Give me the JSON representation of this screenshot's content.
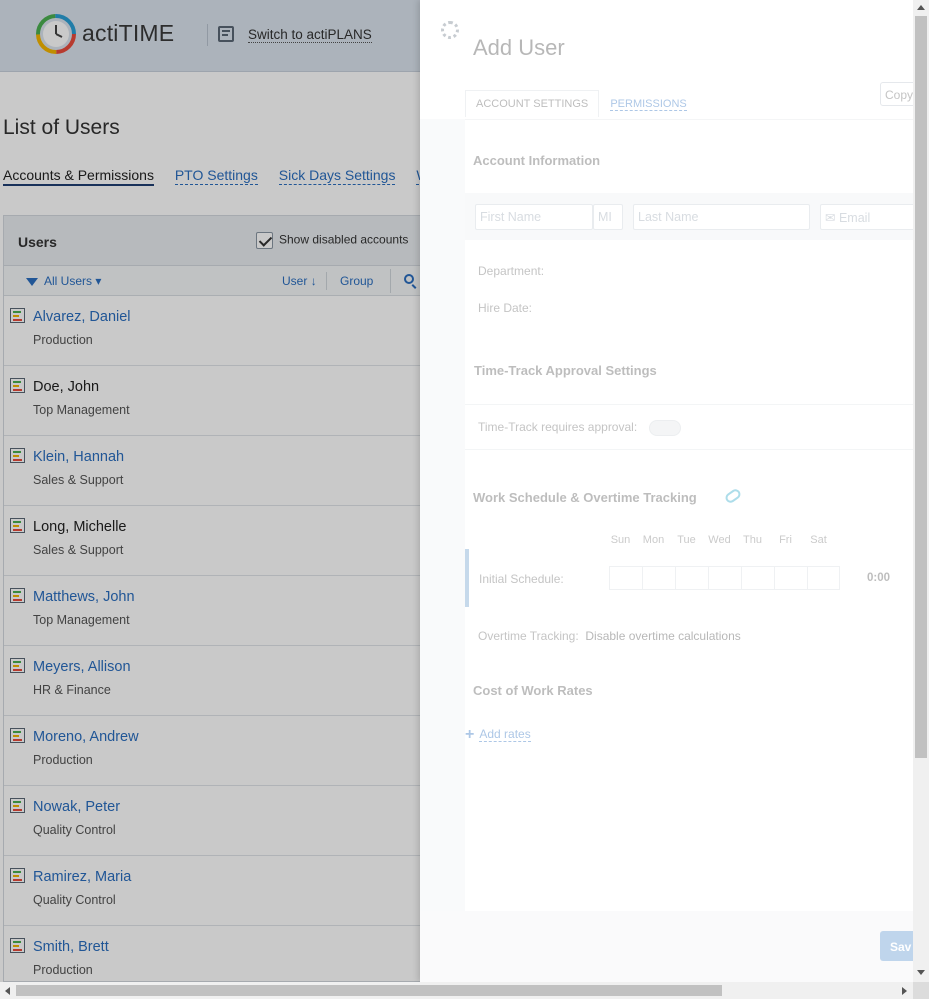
{
  "header": {
    "app_name": "actiTIME",
    "switch_link": "Switch to actiPLANS"
  },
  "page": {
    "title": "List of Users",
    "tabs": [
      {
        "label": "Accounts & Permissions",
        "active": true
      },
      {
        "label": "PTO Settings",
        "active": false
      },
      {
        "label": "Sick Days Settings",
        "active": false
      },
      {
        "label": "W",
        "active": false
      }
    ]
  },
  "users_panel": {
    "title": "Users",
    "show_disabled_label": "Show disabled accounts",
    "show_disabled_checked": true,
    "filter_label": "All Users",
    "sort_user": "User",
    "sort_group": "Group",
    "rows": [
      {
        "name": "Alvarez, Daniel",
        "dept": "Production",
        "link": true
      },
      {
        "name": "Doe, John",
        "dept": "Top Management",
        "link": false
      },
      {
        "name": "Klein, Hannah",
        "dept": "Sales & Support",
        "link": true
      },
      {
        "name": "Long, Michelle",
        "dept": "Sales & Support",
        "link": false
      },
      {
        "name": "Matthews, John",
        "dept": "Top Management",
        "link": true
      },
      {
        "name": "Meyers, Allison",
        "dept": "HR & Finance",
        "link": true
      },
      {
        "name": "Moreno, Andrew",
        "dept": "Production",
        "link": true
      },
      {
        "name": "Nowak, Peter",
        "dept": "Quality Control",
        "link": true
      },
      {
        "name": "Ramirez, Maria",
        "dept": "Quality Control",
        "link": true
      },
      {
        "name": "Smith, Brett",
        "dept": "Production",
        "link": true
      }
    ]
  },
  "drawer": {
    "title": "Add User",
    "copy_label": "Copy",
    "tabs": {
      "account": "ACCOUNT SETTINGS",
      "permissions": "PERMISSIONS"
    },
    "account_info": {
      "heading": "Account Information",
      "first_name_placeholder": "First Name",
      "mi_placeholder": "MI",
      "last_name_placeholder": "Last Name",
      "email_placeholder": "Email",
      "department_label": "Department:",
      "hire_date_label": "Hire Date:"
    },
    "approval": {
      "heading": "Time-Track Approval Settings",
      "requires_label": "Time-Track requires approval:"
    },
    "schedule": {
      "heading": "Work Schedule & Overtime Tracking",
      "days": [
        "Sun",
        "Mon",
        "Tue",
        "Wed",
        "Thu",
        "Fri",
        "Sat"
      ],
      "initial_label": "Initial Schedule:",
      "total": "0:00",
      "overtime_label": "Overtime Tracking:",
      "overtime_value": "Disable overtime calculations"
    },
    "rates": {
      "heading": "Cost of Work Rates",
      "add_label": "Add rates"
    },
    "save_label": "Sav"
  }
}
